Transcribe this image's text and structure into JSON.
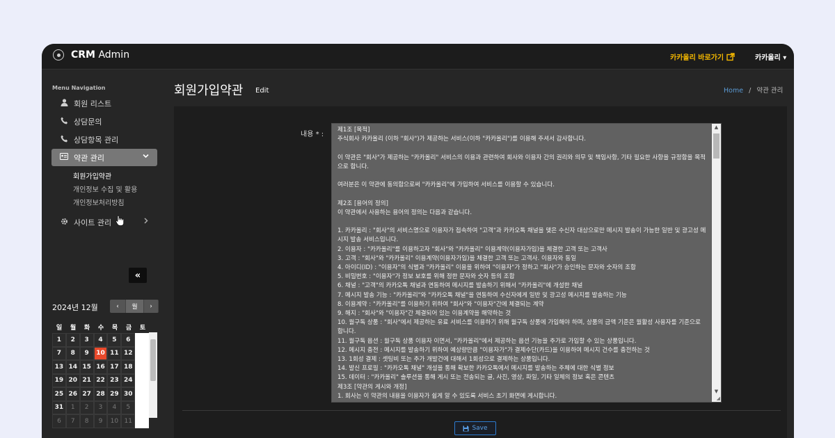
{
  "topbar": {
    "brand_bold": "CRM",
    "brand_rest": " Admin",
    "ext_link": "카카올리 바로가기",
    "user": "카카올리 ▾"
  },
  "sidebar": {
    "heading": "Menu Navigation",
    "items": [
      {
        "label": "회원 리스트",
        "icon": "user-icon"
      },
      {
        "label": "상담문의",
        "icon": "phone-icon"
      },
      {
        "label": "상담항목 관리",
        "icon": "phone-icon"
      },
      {
        "label": "약관 관리",
        "icon": "id-card-icon"
      },
      {
        "label": "사이트 관리",
        "icon": "gear-icon"
      }
    ],
    "sub_items": [
      "회원가입약관",
      "개인정보 수집 및 활용",
      "개인정보처리방침"
    ],
    "collapse": "«"
  },
  "calendar": {
    "title": "2024년 12월",
    "prev": "‹",
    "month": "월",
    "next": "›",
    "weekdays": [
      "일",
      "월",
      "화",
      "수",
      "목",
      "금",
      "토"
    ],
    "days": [
      [
        "1",
        "2",
        "3",
        "4",
        "5",
        "6",
        "7"
      ],
      [
        "8",
        "9",
        "10",
        "11",
        "12",
        "13",
        "14"
      ],
      [
        "15",
        "16",
        "17",
        "18",
        "19",
        "20",
        "21"
      ],
      [
        "22",
        "23",
        "24",
        "25",
        "26",
        "27",
        "28"
      ],
      [
        "29",
        "30",
        "31",
        "1",
        "2",
        "3",
        "4"
      ],
      [
        "5",
        "6",
        "7",
        "8",
        "9",
        "10",
        "11"
      ]
    ],
    "today": "10"
  },
  "main": {
    "title": "회원가입약관",
    "subtitle": "Edit",
    "breadcrumb_home": "Home",
    "breadcrumb_sep": "/",
    "breadcrumb_current": "약관 관리",
    "field_label": "내용 * :",
    "content": "제1조 [목적]\n주식회사 카카올리 (이하 \"회사\")가 제공하는 서비스(이하 \"카카올리\")를 이용해 주셔서 감사합니다.\n\n이 약관은 \"회사\"가 제공하는 \"카카올리\" 서비스의 이용과 관련하여 회사와 이용자 간의 권리와 의무 및 책임사항, 기타 필요한 사항을 규정함을 목적으로 합니다.\n\n여러분은 이 약관에 동의함으로써 \"카카올리\"에 가입하여 서비스를 이용할 수 있습니다.\n\n제2조 [용어의 정의]\n이 약관에서 사용하는 용어의 정의는 다음과 같습니다.\n\n1. 카카올리 : \"회사\"의 서비스명으로 이용자가 접속하여 \"고객\"과 카카오톡 채널을 맺은 수신자 대상으로만 메시지 발송이 가능한 일반 및 광고성 메시지 발송 서비스입니다.\n2. 이용자 : \"카카올리\"를 이용하고자 \"회사\"와 \"카카올리\" 이용계약(이용자가입)을 체결한 고객 또는 고객사\n3. 고객 : \"회사\"와 \"카카올리\" 이용계약(이용자가입)을 체결한 고객 또는 고객사. 이용자와 동일\n4. 아이디(ID) : \"이용자\"의 식별과 \"카카올리\" 이용을 위하여 \"이용자\"가 정하고 \"회사\"가 승인하는 문자와 숫자의 조합\n5. 비밀번호 : \"이용자\"가 정보 보호를 위해 정한 문자와 숫자 등의 조합\n6. 채널 : \"고객\"의 카카오톡 채널과 연동하여 메시지를 발송하기 위해서 \"카카올리\"에 개설한 채널\n7. 메시지 발송 기능 : \"카카올리\"와 \"카카오톡 채널\"을 연동하여 수신자에게 일반 및 광고성 메시지를 발송하는 기능\n8. 이용계약 : \"카카올리\"를 이용하기 위하여 \"회사\"와 \"이용자\"간에 체결되는 계약\n9. 해지 : \"회사\"와 \"이용자\"간 체결되어 있는 이용계약을 해약하는 것\n10. 월구독 상품 : \"회사\"에서 제공하는 유료 서비스를 이용하기 위해 월구독 상품에 가입해야 하며, 상품의 금액 기준은 월활성 사용자를 기준으로 합니다.\n11. 월구독 옵션 : 월구독 상품 이용자 이면서, \"카카올리\"에서 제공하는 옵션 기능을 추가로 가입할 수 있는 상품입니다.\n12. 메시지 충전 : 메시지를 발송하기 위하여 예상량만큼 \"이용자가\"가 결제수단(카드)을 이용하여 메시지 건수를 충전하는 것\n13. 1회성 결제 : 셋팅비 또는 추가 개발건에 대해서 1회성으로 결제하는 상품입니다.\n14. 발신 프로필 : \"카카오톡 채널\" 개설을 통해 확보한 카카오톡에서 메시지를 발송하는 주체에 대한 식별 정보\n15. 데이터 : \"카카올리\" 솔루션을 통해 게시 또는 전송되는 글, 사진, 영상, 파일, 기타 일체의 정보 혹은 콘텐츠\n제3조 [약관의 게시와 개정]\n1. 회사는 이 약관의 내용을 이용자가 쉽게 알 수 있도록 서비스 초기 화면에 게시합니다.",
    "save_label": "Save"
  }
}
